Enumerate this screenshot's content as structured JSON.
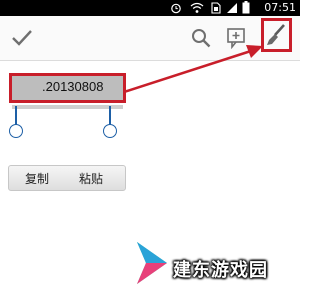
{
  "status_bar": {
    "time": "07:51",
    "icons": [
      "alarm-icon",
      "wifi-icon",
      "sim-icon",
      "signal-icon",
      "battery-icon"
    ]
  },
  "action_bar": {
    "icons": [
      "check-icon",
      "search-icon",
      "add-note-icon",
      "brush-icon"
    ]
  },
  "text_field": {
    "value": ".20130808"
  },
  "context_menu": {
    "copy_label": "复制",
    "paste_label": "粘贴"
  },
  "watermark": {
    "text": "建东游戏园"
  },
  "colors": {
    "highlight": "#c81e2a",
    "handle": "#1d5fa6",
    "status_bar": "#000000"
  }
}
